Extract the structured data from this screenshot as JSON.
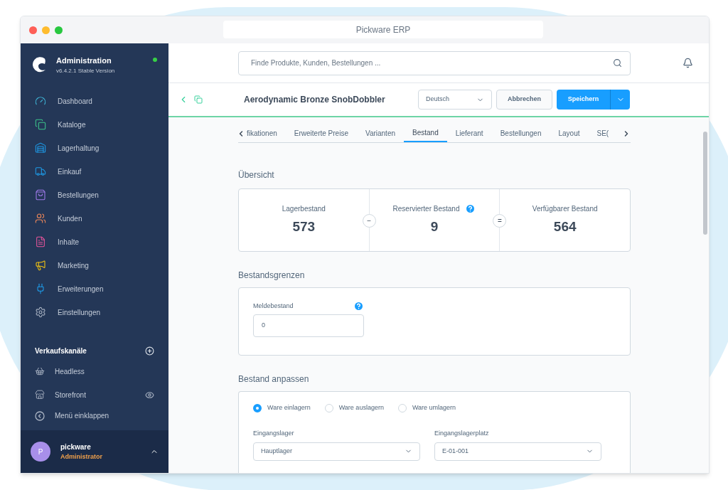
{
  "window": {
    "title": "Pickware ERP"
  },
  "sidebar": {
    "app_title": "Administration",
    "version": "v6.4.2.1 Stable Version",
    "items": [
      {
        "label": "Dashboard"
      },
      {
        "label": "Kataloge"
      },
      {
        "label": "Lagerhaltung"
      },
      {
        "label": "Einkauf"
      },
      {
        "label": "Bestellungen"
      },
      {
        "label": "Kunden"
      },
      {
        "label": "Inhalte"
      },
      {
        "label": "Marketing"
      },
      {
        "label": "Erweiterungen"
      },
      {
        "label": "Einstellungen"
      }
    ],
    "channels_title": "Verkaufskanäle",
    "channels": [
      {
        "label": "Headless",
        "visible_toggle": false
      },
      {
        "label": "Storefront",
        "visible_toggle": true
      }
    ],
    "collapse": "Menü einklappen",
    "user": {
      "initial": "P",
      "name": "pickware",
      "role": "Administrator"
    }
  },
  "search": {
    "placeholder": "Finde Produkte, Kunden, Bestellungen ..."
  },
  "product": {
    "title": "Aerodynamic Bronze SnobDobbler",
    "language": "Deutsch",
    "cancel": "Abbrechen",
    "save": "Speichern"
  },
  "tabs": [
    {
      "label": "fikationen",
      "selected": false
    },
    {
      "label": "Erweiterte Preise",
      "selected": false
    },
    {
      "label": "Varianten",
      "selected": false
    },
    {
      "label": "Bestand",
      "selected": true
    },
    {
      "label": "Lieferant",
      "selected": false
    },
    {
      "label": "Bestellungen",
      "selected": false
    },
    {
      "label": "Layout",
      "selected": false
    },
    {
      "label": "SE(",
      "selected": false
    }
  ],
  "overview": {
    "title": "Übersicht",
    "stats": [
      {
        "label": "Lagerbestand",
        "value": "573",
        "help": false
      },
      {
        "label": "Reservierter Bestand",
        "value": "9",
        "help": true
      },
      {
        "label": "Verfügbarer Bestand",
        "value": "564",
        "help": false
      }
    ],
    "operators": [
      "−",
      "="
    ]
  },
  "limits": {
    "title": "Bestandsgrenzen",
    "field": {
      "label": "Meldebestand",
      "value": "0",
      "help": true
    }
  },
  "adjust": {
    "title": "Bestand anpassen",
    "modes": [
      {
        "label": "Ware einlagern",
        "selected": true
      },
      {
        "label": "Ware auslagern",
        "selected": false
      },
      {
        "label": "Ware umlagern",
        "selected": false
      }
    ],
    "selects": [
      {
        "label": "Eingangslager",
        "value": "Hauptlager"
      },
      {
        "label": "Eingangslagerplatz",
        "value": "E-01-001"
      }
    ]
  }
}
